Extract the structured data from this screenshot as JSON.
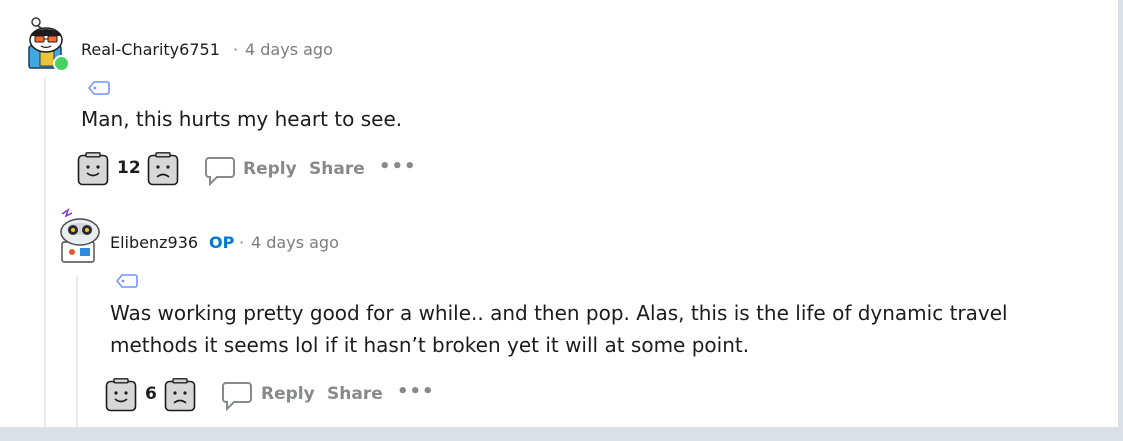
{
  "comments": [
    {
      "username": "Real-Charity6751",
      "separator": "·",
      "time": "4 days ago",
      "body": "Man, this hurts my heart to see.",
      "votes": "12",
      "reply_label": "Reply",
      "share_label": "Share",
      "more_label": "•••",
      "online": true
    },
    {
      "username": "Elibenz936",
      "op_badge": "OP",
      "separator": "·",
      "time": "4 days ago",
      "body_lines": [
        "Was working pretty good for a while.. and then pop. Alas, this is the life of dynamic travel",
        "methods it seems lol if it hasn’t broken yet it will at some point."
      ],
      "votes": "6",
      "reply_label": "Reply",
      "share_label": "Share",
      "more_label": "•••"
    }
  ],
  "colors": {
    "op_badge": "#0079d3",
    "online_indicator": "#46d160",
    "muted_text": "#7c7c7c",
    "action_text": "#878a8c"
  },
  "icons": {
    "upvote": "happy-face-upvote-icon",
    "downvote": "sad-face-downvote-icon",
    "reply": "speech-bubble-icon",
    "flair": "tag-icon",
    "more": "ellipsis-icon"
  }
}
